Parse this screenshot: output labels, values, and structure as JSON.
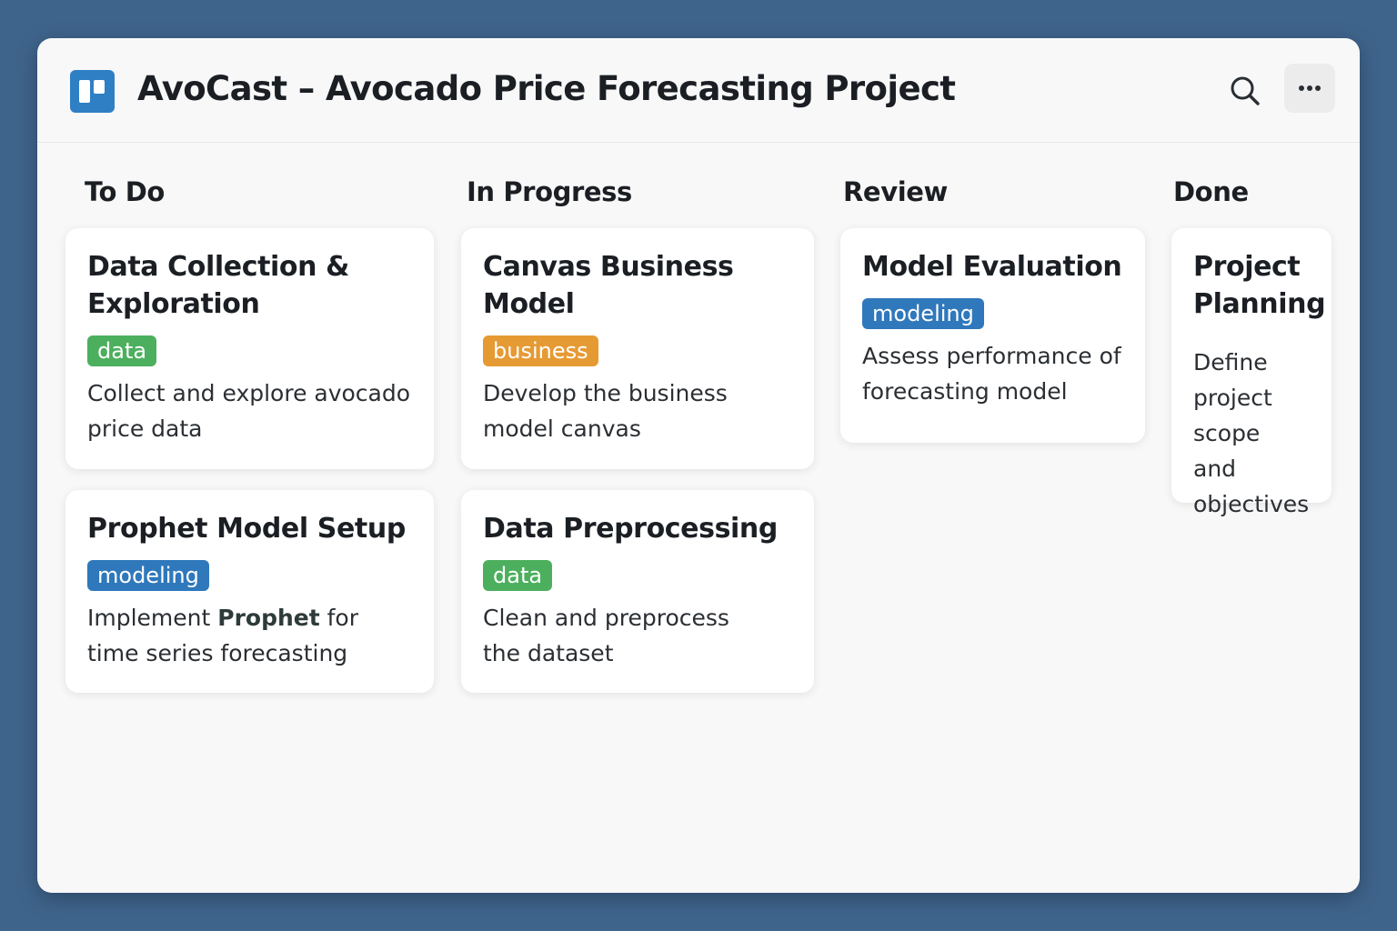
{
  "header": {
    "title": "AvoCast – Avocado Price Forecasting Project",
    "logo_icon": "board-icon",
    "search_icon": "search-icon",
    "more_icon": "more-horizontal-icon"
  },
  "colors": {
    "background": "#3f648c",
    "tag_data": "#4caf5e",
    "tag_business": "#e69a33",
    "tag_modeling": "#2f78bb",
    "logo": "#2f7fc4"
  },
  "columns": [
    {
      "title": "To Do",
      "cards": [
        {
          "title": "Data Collection & Exploration",
          "tag": "data",
          "description": "Collect and explore avocado price data"
        },
        {
          "title": "Prophet Model Setup",
          "tag": "modeling",
          "description_pre": "Implement ",
          "description_bold": "Prophet",
          "description_post": " for time series forecasting"
        }
      ]
    },
    {
      "title": "In Progress",
      "cards": [
        {
          "title": "Canvas Business Model",
          "tag": "business",
          "description": "Develop the business model canvas"
        },
        {
          "title": "Data Preprocessing",
          "tag": "data",
          "description": "Clean and preprocess the dataset"
        }
      ]
    },
    {
      "title": "Review",
      "cards": [
        {
          "title": "Model Evaluation",
          "tag": "modeling",
          "description": "Assess performance of forecasting model"
        }
      ]
    },
    {
      "title": "Done",
      "cards": [
        {
          "title": "Project Planning",
          "tag": "",
          "description": "Define project scope and objectives"
        }
      ]
    }
  ]
}
